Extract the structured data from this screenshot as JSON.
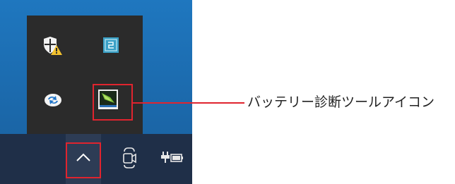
{
  "annotation": {
    "label": "バッテリー診断ツールアイコン",
    "accent_color": "#e0242e"
  },
  "tray_overflow": {
    "icons": [
      {
        "name": "windows-security-warning-icon"
      },
      {
        "name": "app-square-icon"
      },
      {
        "name": "sync-arrows-icon"
      },
      {
        "name": "battery-diagnostic-tool-icon"
      }
    ]
  },
  "taskbar": {
    "icons": [
      {
        "name": "chevron-up-icon"
      },
      {
        "name": "meet-now-icon"
      },
      {
        "name": "power-plug-battery-icon"
      }
    ]
  }
}
